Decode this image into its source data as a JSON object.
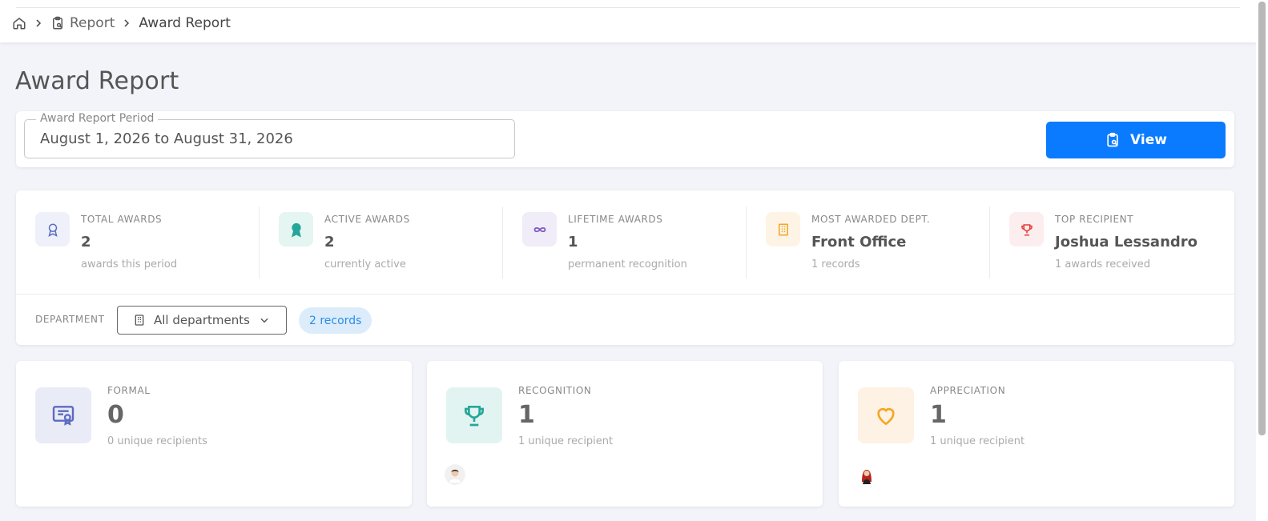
{
  "breadcrumb": {
    "home_icon": "home-icon",
    "items": [
      {
        "label": "Report",
        "icon": "clipboard-search-icon"
      },
      {
        "label": "Award Report"
      }
    ]
  },
  "page_title": "Award Report",
  "period": {
    "legend": "Award Report Period",
    "value": "August 1, 2026 to August 31, 2026",
    "view_label": "View"
  },
  "stats": [
    {
      "label": "TOTAL AWARDS",
      "value": "2",
      "sub": "awards this period",
      "icon": "award-ribbon-icon",
      "color": "#5b6bc0",
      "bg": "#eef0fa"
    },
    {
      "label": "ACTIVE AWARDS",
      "value": "2",
      "sub": "currently active",
      "icon": "award-ribbon-filled-icon",
      "color": "#26a69a",
      "bg": "#e4f5f2"
    },
    {
      "label": "LIFETIME AWARDS",
      "value": "1",
      "sub": "permanent recognition",
      "icon": "infinity-icon",
      "color": "#7e57c2",
      "bg": "#f0ecf8"
    },
    {
      "label": "MOST AWARDED DEPT.",
      "value": "Front Office",
      "sub": "1 records",
      "icon": "building-icon",
      "color": "#f5a623",
      "bg": "#fdf4e6"
    },
    {
      "label": "TOP RECIPIENT",
      "value": "Joshua Lessandro",
      "sub": "1 awards received",
      "icon": "trophy-icon",
      "color": "#e53935",
      "bg": "#fceeee"
    }
  ],
  "department": {
    "label": "DEPARTMENT",
    "selected": "All departments",
    "records_badge": "2 records"
  },
  "award_types": [
    {
      "label": "FORMAL",
      "value": "0",
      "sub": "0 unique recipients",
      "icon": "certificate-icon",
      "color": "#5c6bc0",
      "bg": "#e9ebf7"
    },
    {
      "label": "RECOGNITION",
      "value": "1",
      "sub": "1 unique recipient",
      "icon": "trophy-icon",
      "color": "#26a69a",
      "bg": "#e2f4f1"
    },
    {
      "label": "APPRECIATION",
      "value": "1",
      "sub": "1 unique recipient",
      "icon": "heart-icon",
      "color": "#f5a623",
      "bg": "#fdf2e3"
    }
  ]
}
